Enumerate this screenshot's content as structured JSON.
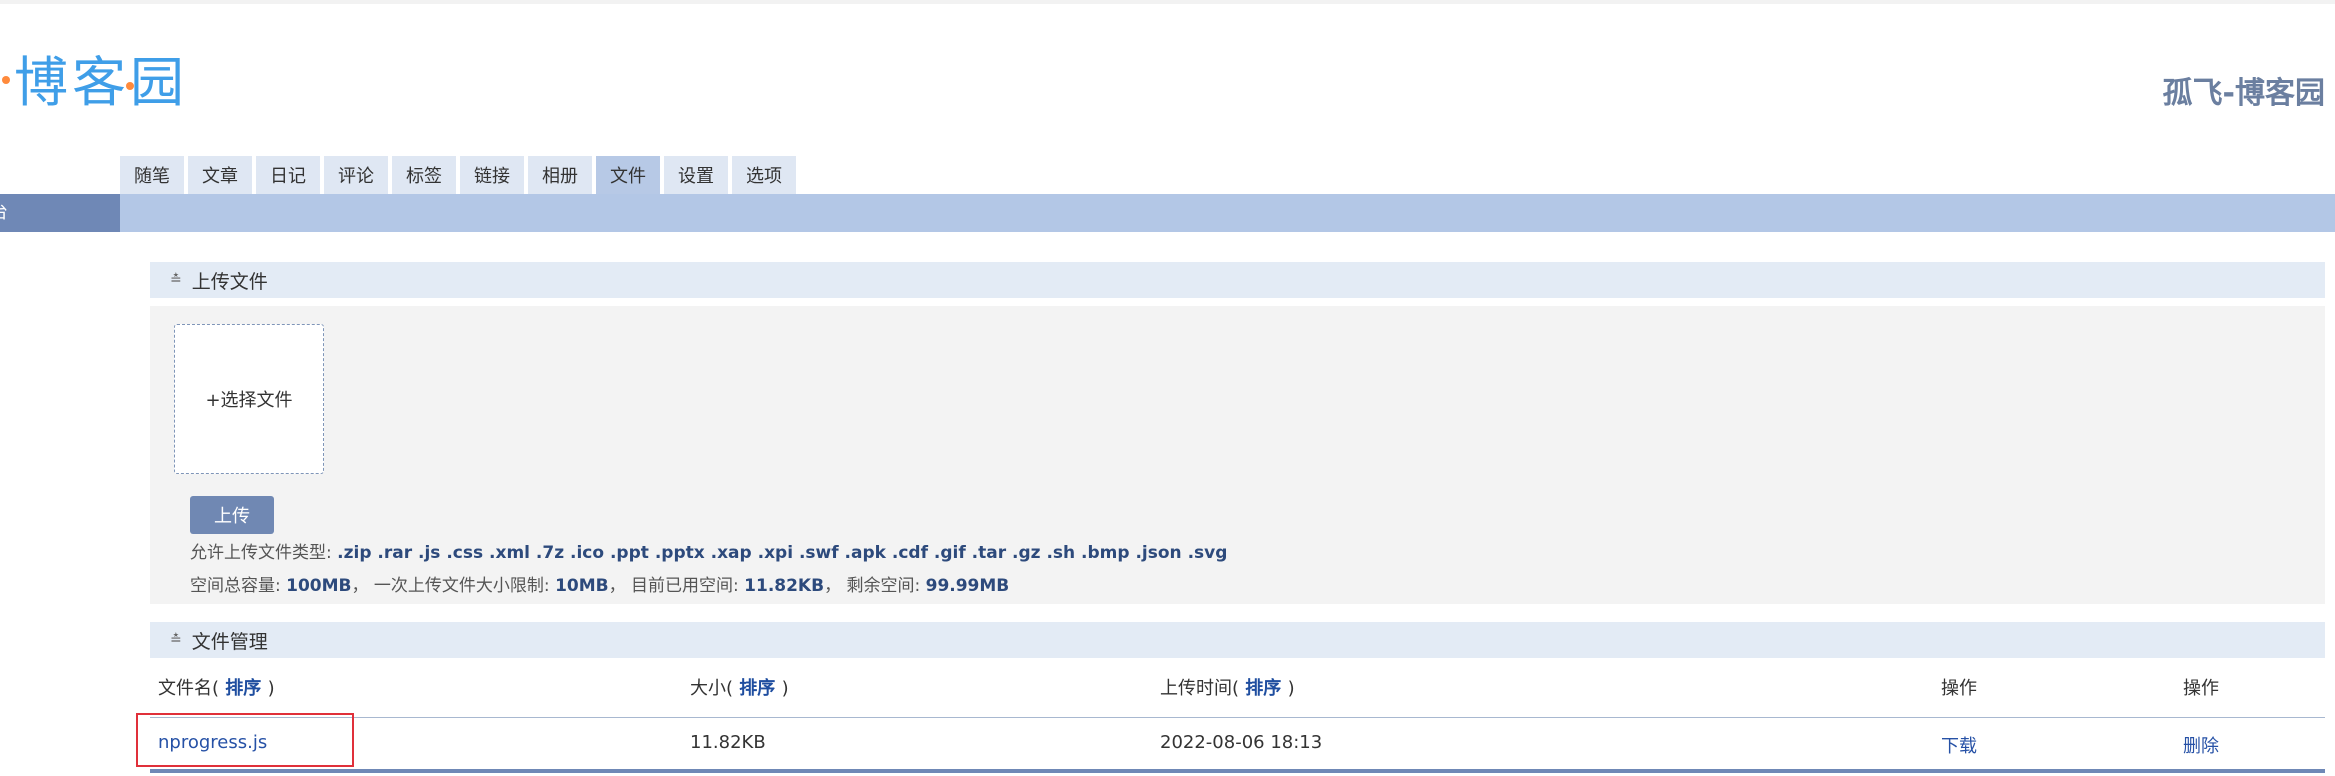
{
  "header": {
    "logo_text": "博客园",
    "site_title": "孤飞-博客园"
  },
  "tabs": [
    {
      "label": "随笔"
    },
    {
      "label": "文章"
    },
    {
      "label": "日记"
    },
    {
      "label": "评论"
    },
    {
      "label": "标签"
    },
    {
      "label": "链接"
    },
    {
      "label": "相册"
    },
    {
      "label": "文件",
      "active": true
    },
    {
      "label": "设置"
    },
    {
      "label": "选项"
    }
  ],
  "leftbar": {
    "item_label": "台"
  },
  "upload_section": {
    "title": "上传文件",
    "choose_file_label": "+选择文件",
    "upload_button": "上传",
    "allowed_types_label": "允许上传文件类型: ",
    "allowed_types": ".zip .rar .js .css .xml .7z .ico .ppt .pptx .xap .xpi .swf .apk .cdf .gif .tar .gz .sh .bmp .json .svg",
    "total_space_label": "空间总容量: ",
    "total_space": "100MB",
    "single_limit_label": "，  一次上传文件大小限制: ",
    "single_limit": "10MB",
    "used_label": "，  目前已用空间: ",
    "used": "11.82KB",
    "remaining_label": "，  剩余空间: ",
    "remaining": "99.99MB"
  },
  "file_section": {
    "title": "文件管理",
    "columns": {
      "name_prefix": "文件名(",
      "name_sort": " 排序 ",
      "name_suffix": ")",
      "size_prefix": "大小(",
      "size_sort": " 排序 ",
      "size_suffix": ")",
      "time_prefix": "上传时间(",
      "time_sort": " 排序 ",
      "time_suffix": ")",
      "op1": "操作",
      "op2": "操作"
    },
    "rows": [
      {
        "name": "nprogress.js",
        "size": "11.82KB",
        "uploaded": "2022-08-06 18:13",
        "download": "下载",
        "delete": "删除"
      }
    ]
  },
  "colors": {
    "accent": "#6f88b6",
    "logo_blue": "#3f9ee8",
    "highlight": "#e0303a"
  }
}
